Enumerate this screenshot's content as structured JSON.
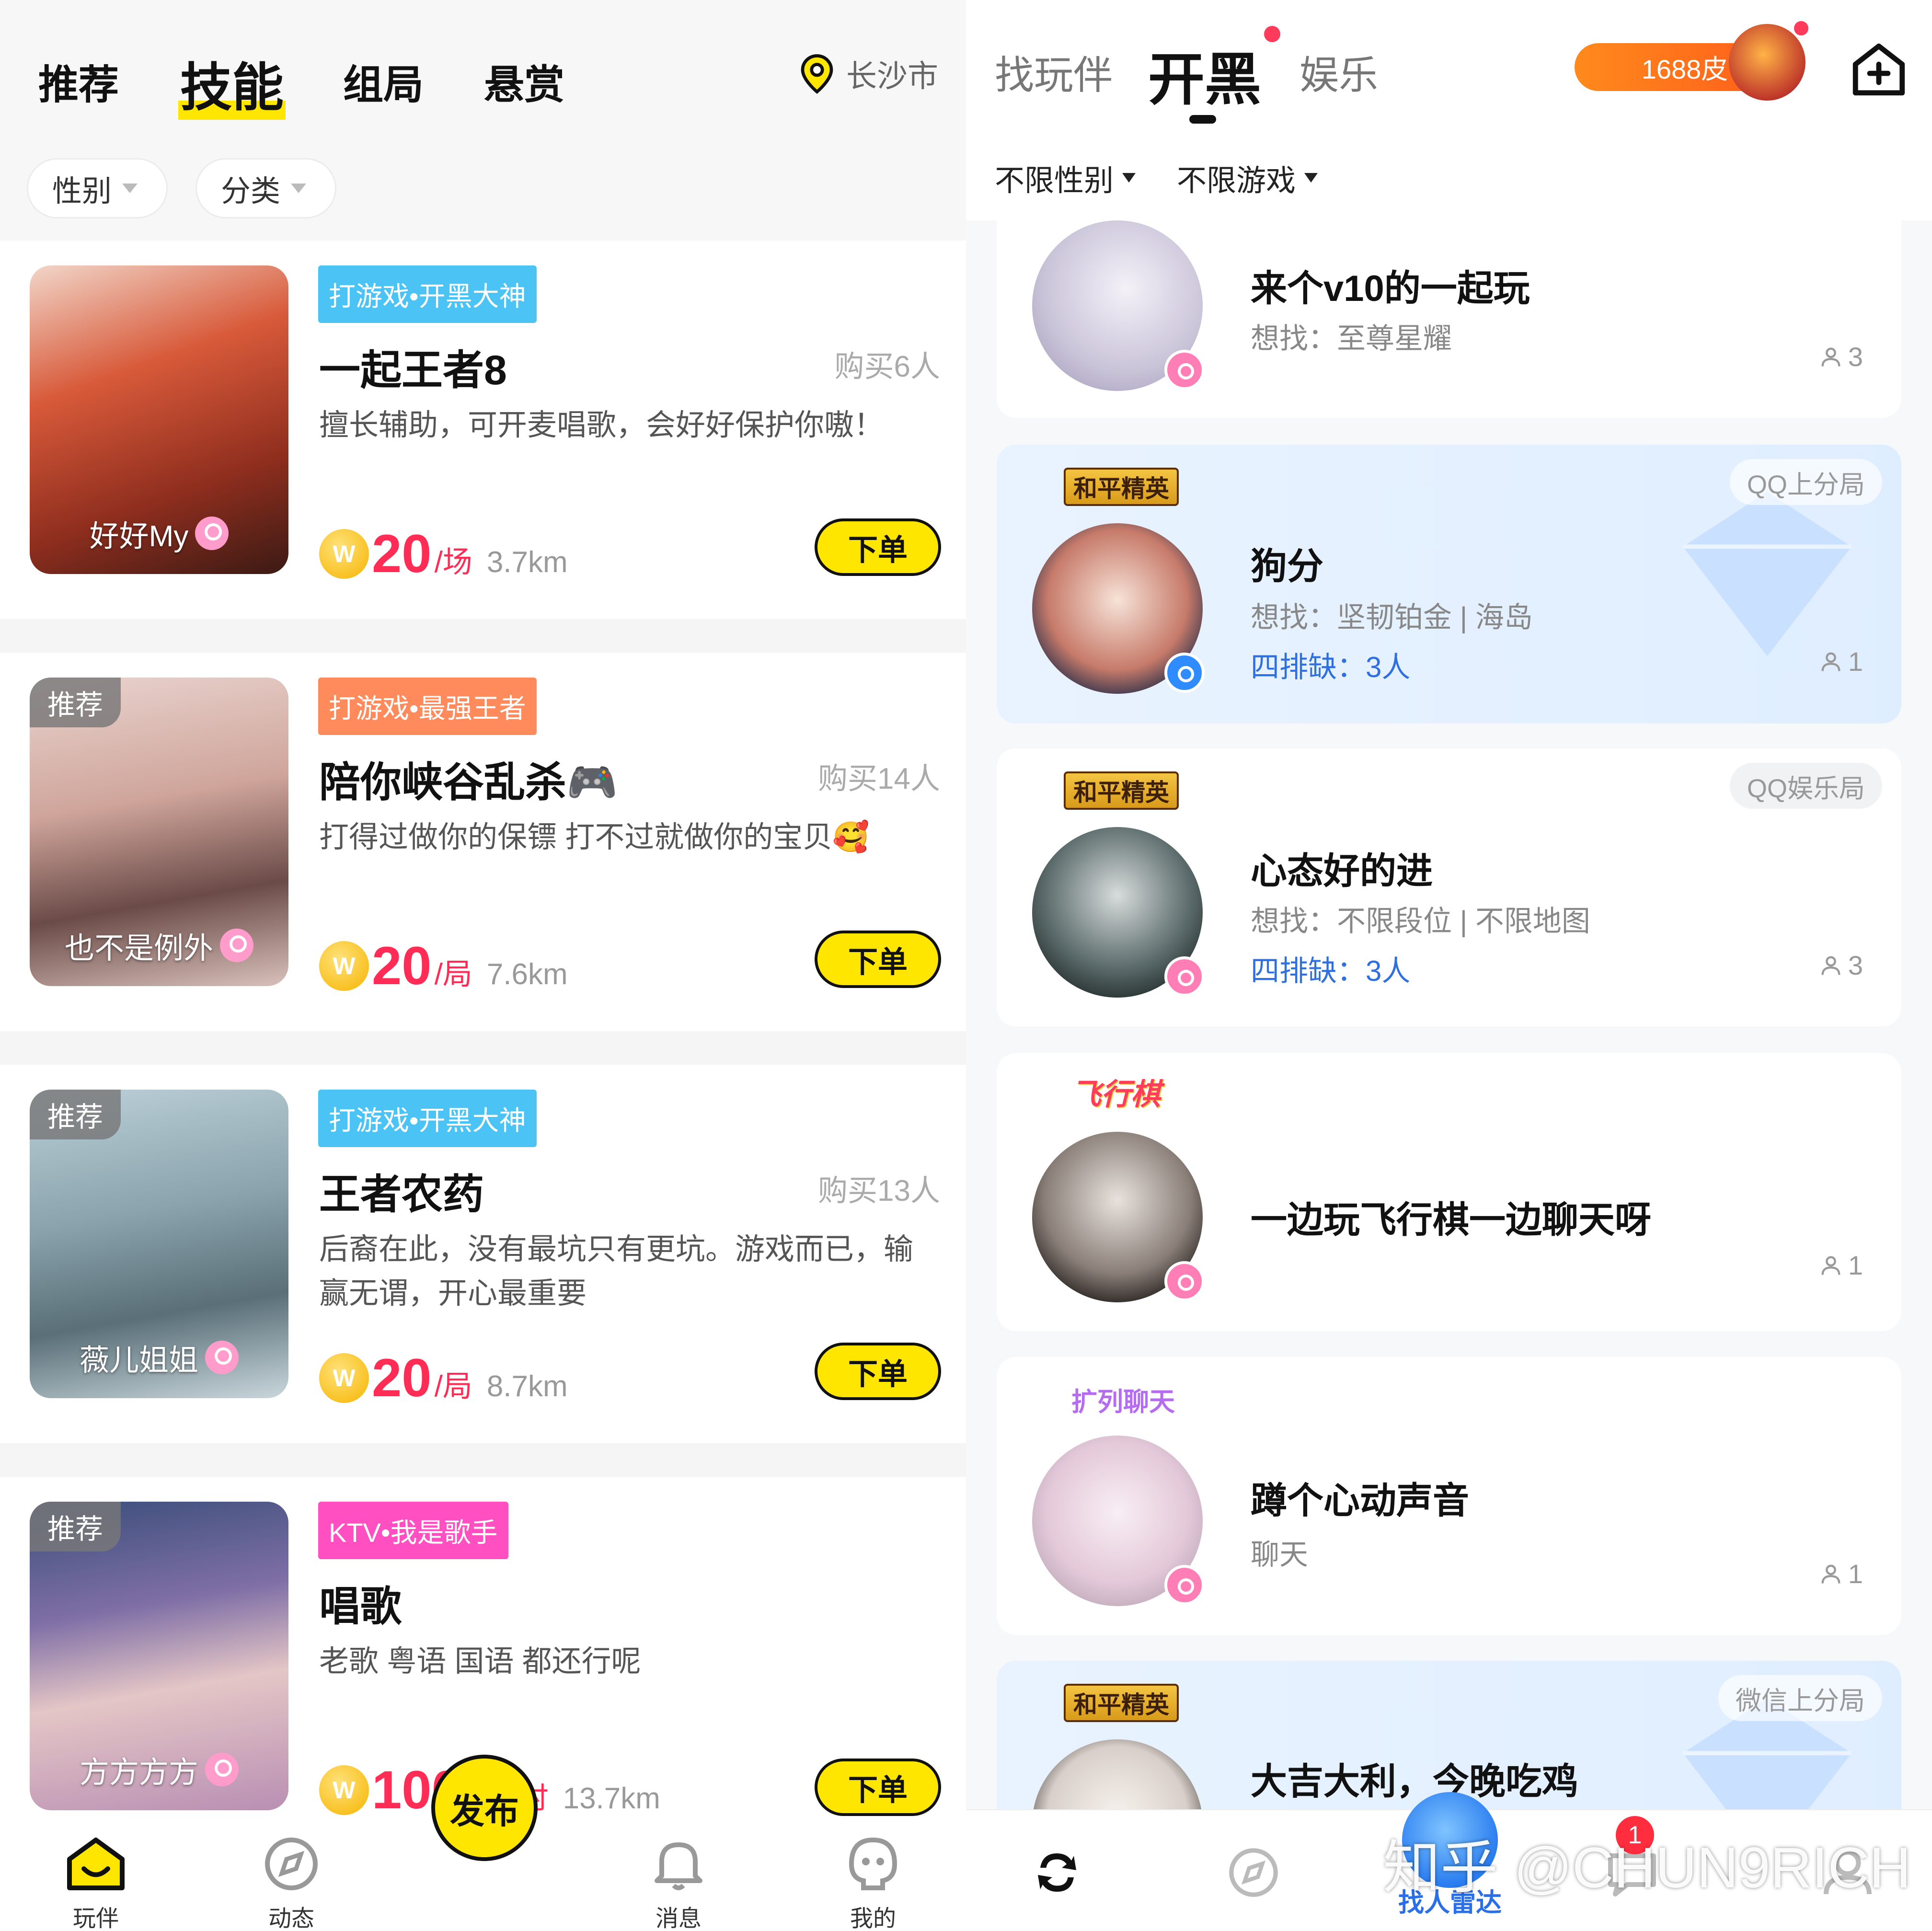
{
  "left": {
    "tabs": [
      {
        "label": "推荐"
      },
      {
        "label": "技能"
      },
      {
        "label": "组局"
      },
      {
        "label": "悬赏"
      }
    ],
    "location": "长沙市",
    "filters": [
      {
        "label": "性别"
      },
      {
        "label": "分类"
      }
    ],
    "cards": [
      {
        "tag": "打游戏•开黑大神",
        "tag_color": "#4cc3f5",
        "title": "一起王者8",
        "bought": "购买6人",
        "desc": "擅长辅助，可开麦唱歌，会好好保护你嗷！",
        "nickname": "好好My",
        "recommended": "",
        "price": "20",
        "unit": "/场",
        "distance": "3.7km",
        "order": "下单"
      },
      {
        "tag": "打游戏•最强王者",
        "tag_color": "#ff8a5b",
        "title": "陪你峡谷乱杀🎮",
        "bought": "购买14人",
        "desc": "打得过做你的保镖 打不过就做你的宝贝🥰",
        "nickname": "也不是例外",
        "recommended": "推荐",
        "price": "20",
        "unit": "/局",
        "distance": "7.6km",
        "order": "下单"
      },
      {
        "tag": "打游戏•开黑大神",
        "tag_color": "#4cc3f5",
        "title": "王者农药",
        "bought": "购买13人",
        "desc": "后裔在此，没有最坑只有更坑。游戏而已，输赢无谓，开心最重要",
        "nickname": "薇儿姐姐",
        "recommended": "推荐",
        "price": "20",
        "unit": "/局",
        "distance": "8.7km",
        "order": "下单"
      },
      {
        "tag": "KTV•我是歌手",
        "tag_color": "#ff4fc1",
        "title": "唱歌",
        "bought": "",
        "desc": "老歌 粤语 国语 都还行呢",
        "nickname": "方方方方",
        "recommended": "推荐",
        "price": "100",
        "unit": "/1小时",
        "distance": "13.7km",
        "order": "下单"
      }
    ],
    "coin_letter": "W",
    "nav": [
      {
        "label": "玩伴"
      },
      {
        "label": "动态"
      },
      {
        "label": "发布"
      },
      {
        "label": "消息"
      },
      {
        "label": "我的"
      }
    ]
  },
  "right": {
    "tabs": [
      {
        "label": "找玩伴"
      },
      {
        "label": "开黑"
      },
      {
        "label": "娱乐"
      }
    ],
    "coins": "1688皮",
    "filters": [
      {
        "label": "不限性别"
      },
      {
        "label": "不限游戏"
      }
    ],
    "rooms": [
      {
        "title": "来个v10的一起玩",
        "seek": "想找：至尊星耀",
        "lack": "",
        "count": "3",
        "corner": "",
        "game": "",
        "gender": "f"
      },
      {
        "title": "狗分",
        "seek": "想找：坚韧铂金 | 海岛",
        "lack": "四排缺：3人",
        "count": "1",
        "corner": "QQ上分局",
        "game": "和平精英",
        "gender": "m"
      },
      {
        "title": "心态好的进",
        "seek": "想找：不限段位 | 不限地图",
        "lack": "四排缺：3人",
        "count": "3",
        "corner": "QQ娱乐局",
        "game": "和平精英",
        "gender": "f"
      },
      {
        "title": "一边玩飞行棋一边聊天呀",
        "seek": "",
        "lack": "",
        "count": "1",
        "corner": "",
        "game": "飞行棋",
        "gender": "f"
      },
      {
        "title": "蹲个心动声音",
        "seek": "聊天",
        "lack": "",
        "count": "1",
        "corner": "",
        "game": "扩列聊天",
        "gender": "f"
      },
      {
        "title": "大吉大利，今晚吃鸡",
        "seek": "",
        "lack": "",
        "count": "",
        "corner": "微信上分局",
        "game": "和平精英",
        "gender": ""
      }
    ],
    "radar_label": "找人雷达",
    "watermark": "知乎 @CHUN9RICH",
    "message_badge": "1"
  },
  "colors": {
    "accent_yellow": "#ffe600",
    "price_red": "#ff2d55",
    "link_blue": "#2f6fe0"
  }
}
